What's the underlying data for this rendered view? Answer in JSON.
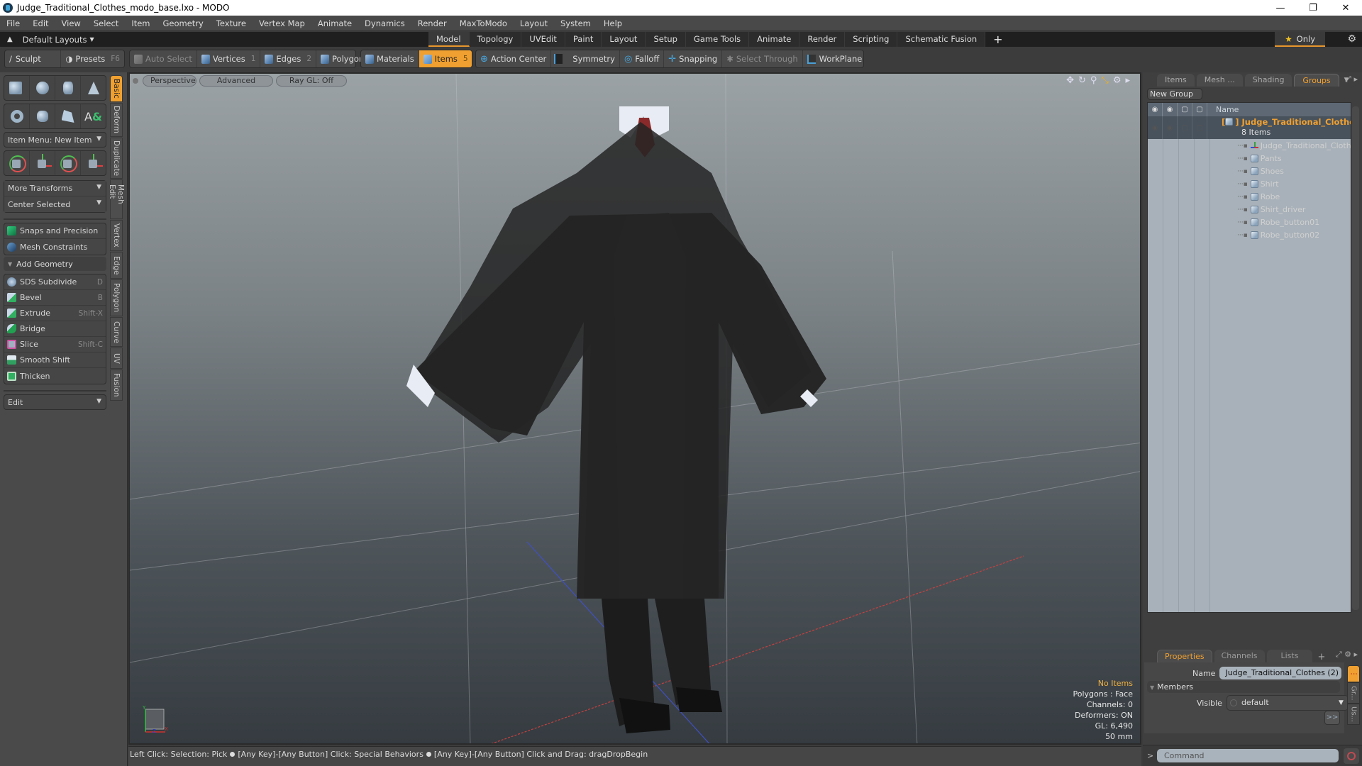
{
  "window": {
    "title": "Judge_Traditional_Clothes_modo_base.lxo - MODO",
    "controls": [
      "minimize",
      "restore",
      "close"
    ]
  },
  "menu": [
    "File",
    "Edit",
    "View",
    "Select",
    "Item",
    "Geometry",
    "Texture",
    "Vertex Map",
    "Animate",
    "Dynamics",
    "Render",
    "MaxToModo",
    "Layout",
    "System",
    "Help"
  ],
  "layoutbar": {
    "layouts_label": "Default Layouts",
    "tabs": [
      "Model",
      "Topology",
      "UVEdit",
      "Paint",
      "Layout",
      "Setup",
      "Game Tools",
      "Animate",
      "Render",
      "Scripting",
      "Schematic Fusion"
    ],
    "active_tab": "Model",
    "add_label": "+",
    "only_label": "Only"
  },
  "toolbar": {
    "sculpt": "Sculpt",
    "presets": "Presets",
    "presets_key": "F6",
    "auto_select": "Auto Select",
    "vertices": "Vertices",
    "vertices_key": "1",
    "edges": "Edges",
    "edges_key": "2",
    "polygons": "Polygons",
    "materials": "Materials",
    "items": "Items",
    "items_key": "5",
    "action_center": "Action Center",
    "symmetry": "Symmetry",
    "falloff": "Falloff",
    "snapping": "Snapping",
    "select_through": "Select Through",
    "workplane": "WorkPlane"
  },
  "leftpanel": {
    "item_menu": "Item Menu: New Item",
    "more_transforms": "More Transforms",
    "center_selected": "Center Selected",
    "snaps": "Snaps and Precision",
    "mesh_constraints": "Mesh Constraints",
    "add_geometry": "Add Geometry",
    "tools": [
      {
        "label": "SDS Subdivide",
        "shortcut": "D"
      },
      {
        "label": "Bevel",
        "shortcut": "B"
      },
      {
        "label": "Extrude",
        "shortcut": "Shift-X"
      },
      {
        "label": "Bridge",
        "shortcut": ""
      },
      {
        "label": "Slice",
        "shortcut": "Shift-C"
      },
      {
        "label": "Smooth Shift",
        "shortcut": ""
      },
      {
        "label": "Thicken",
        "shortcut": ""
      }
    ],
    "edit": "Edit",
    "vtabs": [
      "Basic",
      "Deform",
      "Duplicate",
      "Mesh Edit",
      "Vertex",
      "Edge",
      "Polygon",
      "Curve",
      "UV",
      "Fusion"
    ]
  },
  "viewport": {
    "view": "Perspective",
    "shading": "Advanced",
    "raygl": "Ray GL: Off",
    "stats": {
      "selection": "No Items",
      "polygons": "Polygons : Face",
      "channels": "Channels: 0",
      "deformers": "Deformers: ON",
      "gl": "GL: 6,490",
      "scale": "50 mm"
    }
  },
  "rightpanel": {
    "tabs": [
      "Items",
      "Mesh ...",
      "Shading",
      "Groups"
    ],
    "active_tab": "Groups",
    "new_group": "New Group",
    "name_header": "Name",
    "group": {
      "name": "Judge_Traditional_Clothe...",
      "count": "8 Items",
      "items": [
        {
          "name": "Judge_Traditional_Clothes",
          "type": "locator"
        },
        {
          "name": "Pants",
          "type": "mesh"
        },
        {
          "name": "Shoes",
          "type": "mesh"
        },
        {
          "name": "Shirt",
          "type": "mesh"
        },
        {
          "name": "Robe",
          "type": "mesh"
        },
        {
          "name": "Shirt_driver",
          "type": "mesh"
        },
        {
          "name": "Robe_button01",
          "type": "mesh"
        },
        {
          "name": "Robe_button02",
          "type": "mesh"
        }
      ]
    },
    "prop_tabs": [
      "Properties",
      "Channels",
      "Lists"
    ],
    "active_prop_tab": "Properties",
    "props": {
      "name_label": "Name",
      "name_value": "Judge_Traditional_Clothes (2)",
      "members": "Members",
      "visible_label": "Visible",
      "visible_value": "default",
      "more": ">>"
    },
    "side_tabs": [
      "Gr...",
      "Us..."
    ],
    "command_placeholder": "Command"
  },
  "statusbar": {
    "parts": [
      "Left Click: Selection: Pick",
      "[Any Key]-[Any Button] Click: Special Behaviors",
      "[Any Key]-[Any Button] Click and Drag: dragDropBegin"
    ]
  },
  "colors": {
    "accent": "#f0a030",
    "panel": "#4a4a4a",
    "list_bg": "#a8b1b9"
  }
}
